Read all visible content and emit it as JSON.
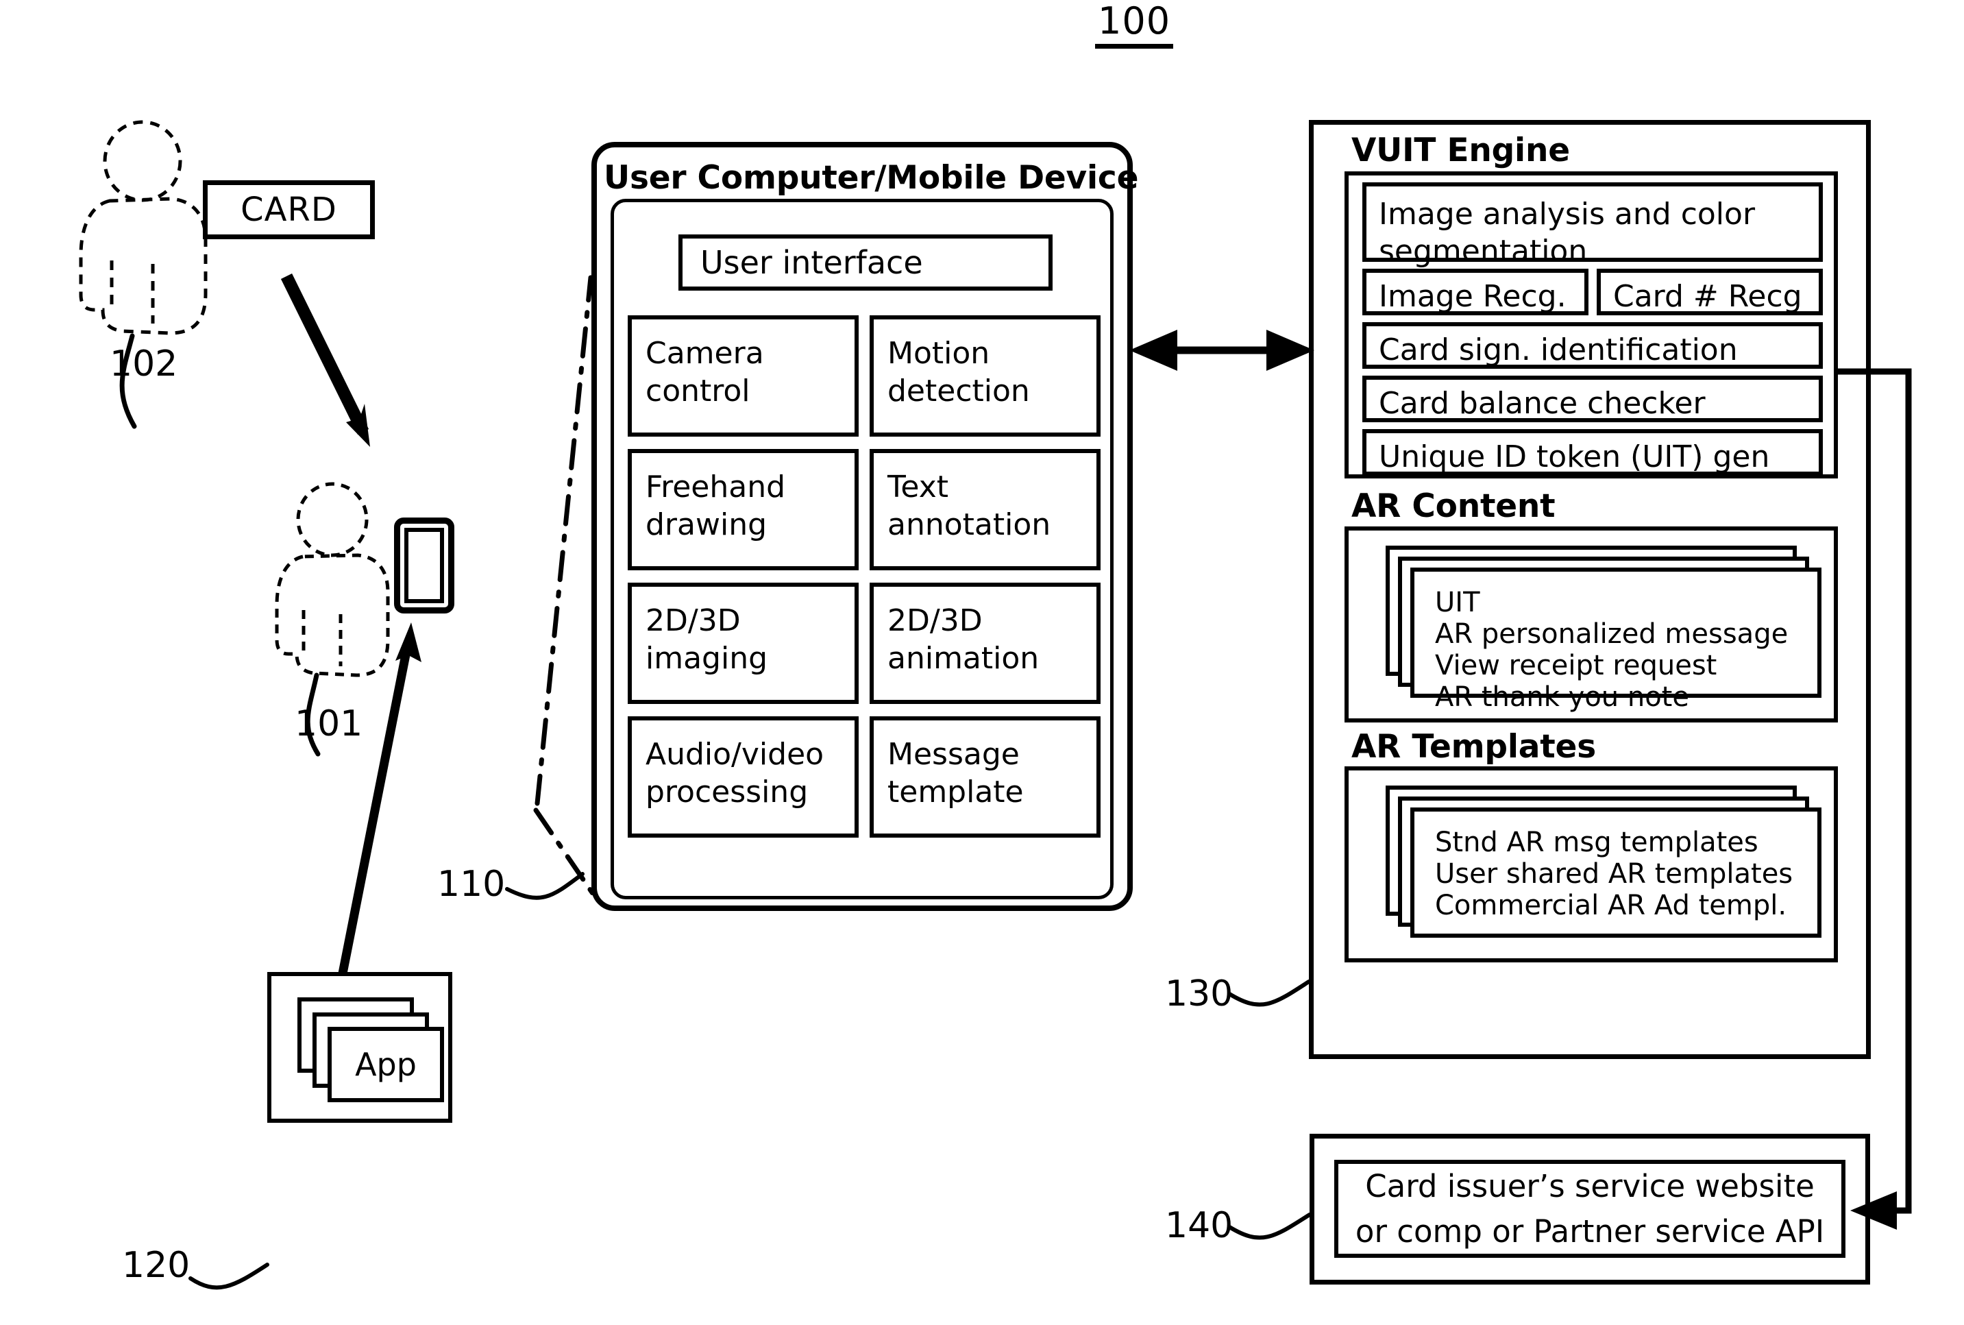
{
  "figure": {
    "number": "100"
  },
  "actors": {
    "sender_ref": "102",
    "recipient_ref": "101",
    "card_label": "CARD"
  },
  "app_block": {
    "ref": "120",
    "label": "App"
  },
  "device": {
    "ref": "110",
    "title": "User Computer/Mobile Device",
    "user_interface_label": "User interface",
    "features": [
      "Camera control",
      "Motion detection",
      "Freehand drawing",
      "Text annotation",
      "2D/3D imaging",
      "2D/3D animation",
      "Audio/video processing",
      "Message template"
    ]
  },
  "vuit": {
    "ref": "130",
    "title": "VUIT Engine",
    "modules": [
      "Image analysis and color segmentation",
      "Image Recg.",
      "Card # Recg",
      "Card sign. identification",
      "Card balance checker",
      "Unique ID token (UIT) gen"
    ],
    "ar_content": {
      "title": "AR Content",
      "items": "UIT\nAR personalized message\nView receipt request\nAR thank you note"
    },
    "ar_templates": {
      "title": "AR Templates",
      "items": "Stnd AR msg templates\nUser shared AR templates\nCommercial AR Ad templ."
    }
  },
  "issuer": {
    "ref": "140",
    "line1": "Card issuer’s service website",
    "line2": "or comp or Partner service API"
  },
  "colors": {
    "stroke": "#000000",
    "background": "#ffffff"
  }
}
